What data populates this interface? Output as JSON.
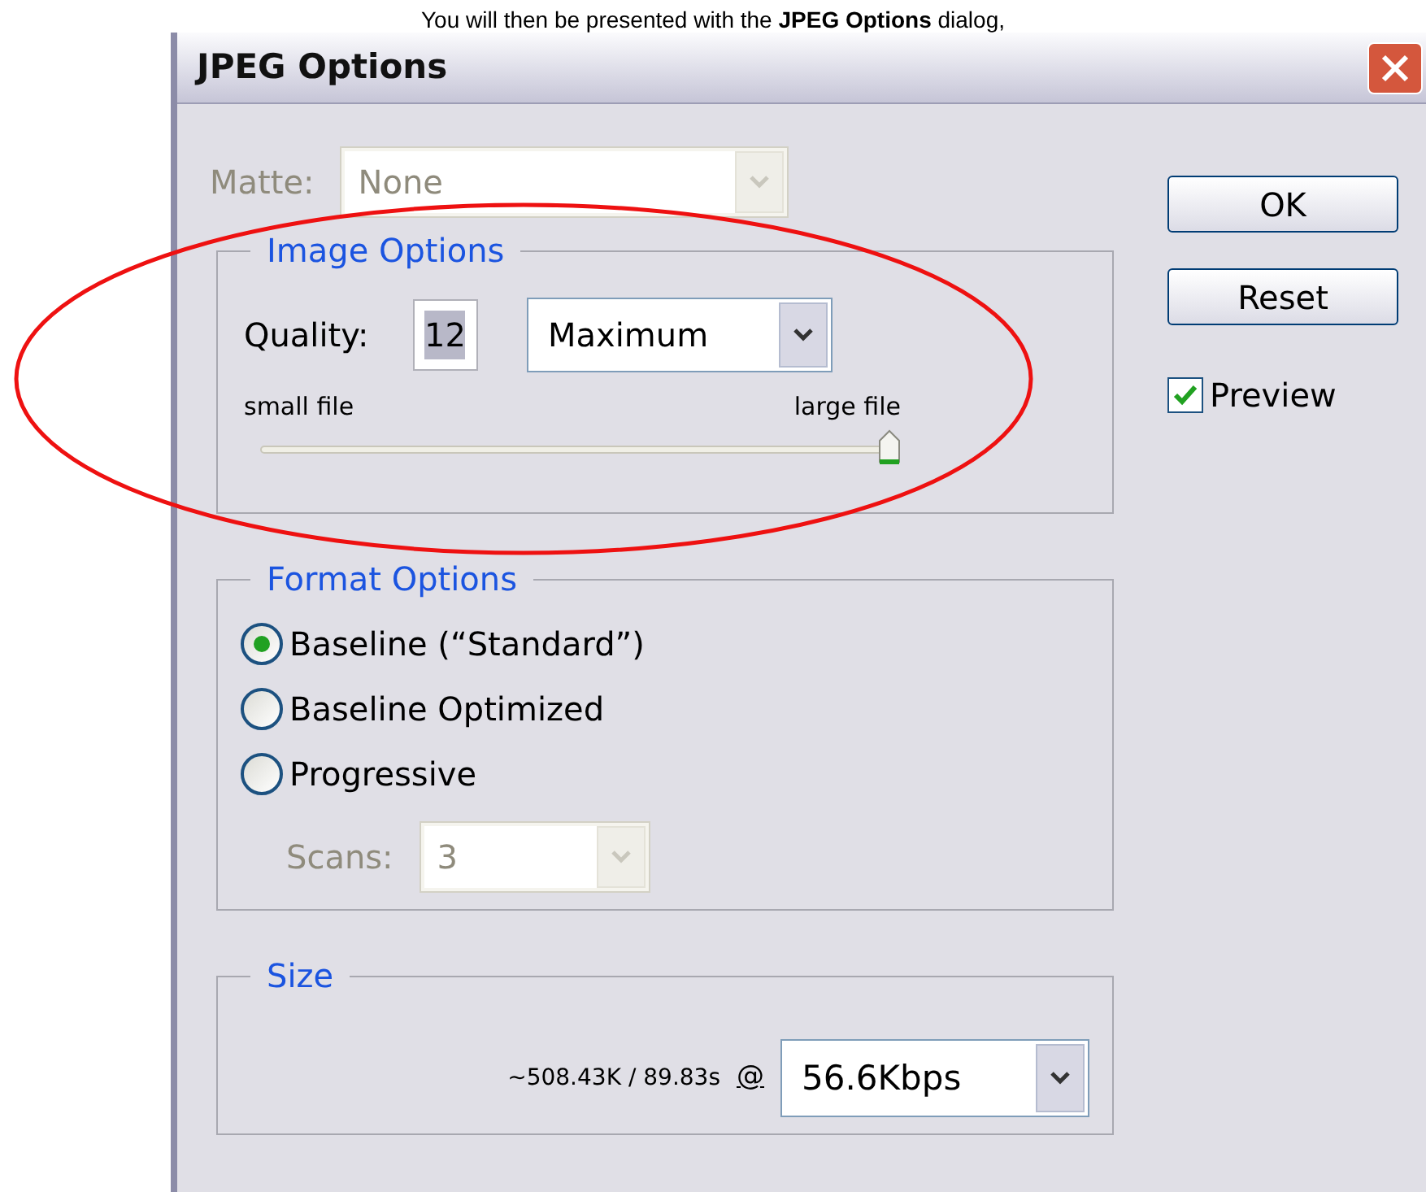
{
  "caption": "You will then be presented with the **JPEG Options** dialog,",
  "window": {
    "title": "JPEG Options"
  },
  "matte": {
    "label": "Matte:",
    "value": "None",
    "disabled": true
  },
  "image_options": {
    "title": "Image Options",
    "quality_label": "Quality:",
    "quality_value": "12",
    "quality_preset": "Maximum",
    "min_label": "small file",
    "max_label": "large file",
    "level": 1
  },
  "format_options": {
    "title": "Format Options",
    "choices": [
      {
        "label": "Baseline (“Standard”)",
        "selected": true
      },
      {
        "label": "Baseline Optimized",
        "selected": false
      },
      {
        "label": "Progressive",
        "selected": false
      }
    ],
    "scans": {
      "label": "Scans:",
      "value": "3",
      "disabled": true
    }
  },
  "size": {
    "title": "Size",
    "estimate": "~508.43K / 89.83s",
    "at": "@",
    "speed": "56.6Kbps"
  },
  "buttons": [
    "OK",
    "Reset"
  ],
  "preview": {
    "label": "Preview",
    "checked": true
  }
}
